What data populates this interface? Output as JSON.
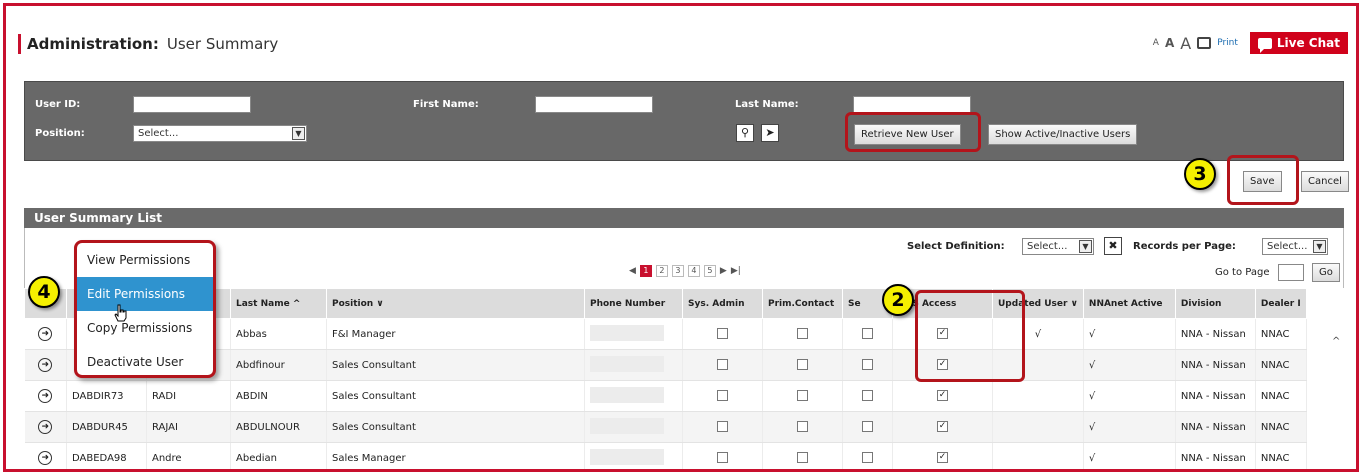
{
  "header": {
    "title": "Administration:",
    "subtitle": "User Summary",
    "font_size_glyphs": [
      "A",
      "A",
      "A"
    ],
    "print_label": "Print",
    "live_chat_label": "Live Chat",
    "accent_color": "#c8102e"
  },
  "search": {
    "user_id_label": "User ID:",
    "first_name_label": "First Name:",
    "last_name_label": "Last Name:",
    "position_label": "Position:",
    "position_value": "Select...",
    "search_icon": "magnifier-icon",
    "cursor_icon": "pointer-icon",
    "retrieve_button": "Retrieve New User",
    "show_button": "Show Active/Inactive Users"
  },
  "actions": {
    "save": "Save",
    "cancel": "Cancel"
  },
  "badges": {
    "b2": "2",
    "b3": "3",
    "b4": "4"
  },
  "list": {
    "title": "User Summary List",
    "select_definition_label": "Select Definition:",
    "select_definition_value": "Select...",
    "records_label": "Records per Page:",
    "records_value": "Select...",
    "go_to_page_label": "Go to Page",
    "go_button": "Go",
    "pages": [
      "1",
      "2",
      "3",
      "4",
      "5"
    ],
    "current_page": "1",
    "columns": [
      "",
      "",
      "",
      "Last Name ^",
      "Position ∨",
      "Phone Number",
      "Sys. Admin",
      "Prim.Contact",
      "Se",
      "DBS Access",
      "Updated User ∨",
      "NNAnet Active",
      "Division",
      "Dealer I"
    ],
    "rows": [
      {
        "user_id": "",
        "first": "",
        "last": "Abbas",
        "position": "F&I Manager",
        "dbs": true,
        "updated": "√",
        "nnanet": "√",
        "division": "NNA - Nissan",
        "dealer": "NNAC"
      },
      {
        "user_id": "",
        "first": "",
        "last": "Abdfinour",
        "position": "Sales Consultant",
        "dbs": true,
        "updated": "",
        "nnanet": "√",
        "division": "NNA - Nissan",
        "dealer": "NNAC"
      },
      {
        "user_id": "DABDIR73",
        "first": "RADI",
        "last": "ABDIN",
        "position": "Sales Consultant",
        "dbs": true,
        "updated": "",
        "nnanet": "√",
        "division": "NNA - Nissan",
        "dealer": "NNAC"
      },
      {
        "user_id": "DABDUR45",
        "first": "RAJAI",
        "last": "ABDULNOUR",
        "position": "Sales Consultant",
        "dbs": true,
        "updated": "",
        "nnanet": "√",
        "division": "NNA - Nissan",
        "dealer": "NNAC"
      },
      {
        "user_id": "DABEDA98",
        "first": "Andre",
        "last": "Abedian",
        "position": "Sales Manager",
        "dbs": true,
        "updated": "",
        "nnanet": "√",
        "division": "NNA - Nissan",
        "dealer": "NNAC"
      }
    ]
  },
  "context_menu": {
    "items": [
      "View Permissions",
      "Edit Permissions",
      "Copy Permissions",
      "Deactivate User"
    ],
    "active_item": "Edit Permissions"
  }
}
